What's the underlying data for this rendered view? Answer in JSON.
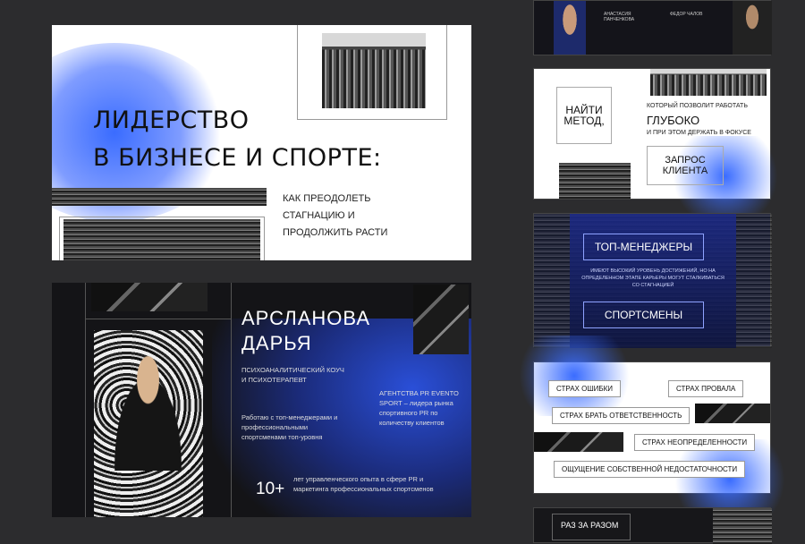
{
  "slide1": {
    "title_line1": "ЛИДЕРСТВО",
    "title_line2": "В БИЗНЕСЕ И СПОРТЕ:",
    "subtitle": "КАК ПРЕОДОЛЕТЬ СТАГНАЦИЮ И ПРОДОЛЖИТЬ РАСТИ"
  },
  "slide2": {
    "name_line1": "АРСЛАНОВА",
    "name_line2": "ДАРЬЯ",
    "role": "ПСИХОАНАЛИТИЧЕСКИЙ КОУЧ И ПСИХОТЕРАПЕВТ",
    "work": "Работаю с топ-менеджерами и профессиональными спортсменами топ-уровня",
    "agency": "АГЕНТСТВА PR EVENTO SPORT – лидера рынка спортивного PR по количеству клиентов",
    "years_value": "10+",
    "years_text": "лет управленческого опыта в сфере PR и маркетинга профессиональных спортсменов"
  },
  "right1": {
    "person1": "АНАСТАСИЯ ПАНЧЕНКОВА",
    "person2": "ФЕДОР ЧАЛОВ"
  },
  "right2": {
    "find_method": "НАЙТИ МЕТОД,",
    "deep_top": "КОТОРЫЙ ПОЗВОЛИТ РАБОТАТЬ",
    "deep": "ГЛУБОКО",
    "deep_bottom": "И ПРИ ЭТОМ ДЕРЖАТЬ В ФОКУСЕ",
    "request": "ЗАПРОС КЛИЕНТА"
  },
  "right3": {
    "managers": "ТОП-МЕНЕДЖЕРЫ",
    "middle": "ИМЕЮТ ВЫСОКИЙ УРОВЕНЬ ДОСТИЖЕНИЙ, НО НА ОПРЕДЕЛЕННОМ ЭТАПЕ КАРЬЕРЫ МОГУТ СТАЛКИВАТЬСЯ СО СТАГНАЦИЕЙ",
    "athletes": "СПОРТСМЕНЫ"
  },
  "right4": {
    "fear1": "СТРАХ ОШИБКИ",
    "fear2": "СТРАХ ПРОВАЛА",
    "fear3": "СТРАХ БРАТЬ ОТВЕТСТВЕННОСТЬ",
    "fear4": "СТРАХ НЕОПРЕДЕЛЕННОСТИ",
    "fear5": "ОЩУЩЕНИЕ СОБСТВЕННОЙ НЕДОСТАТОЧНОСТИ"
  },
  "right5": {
    "text": "РАЗ ЗА РАЗОМ"
  }
}
